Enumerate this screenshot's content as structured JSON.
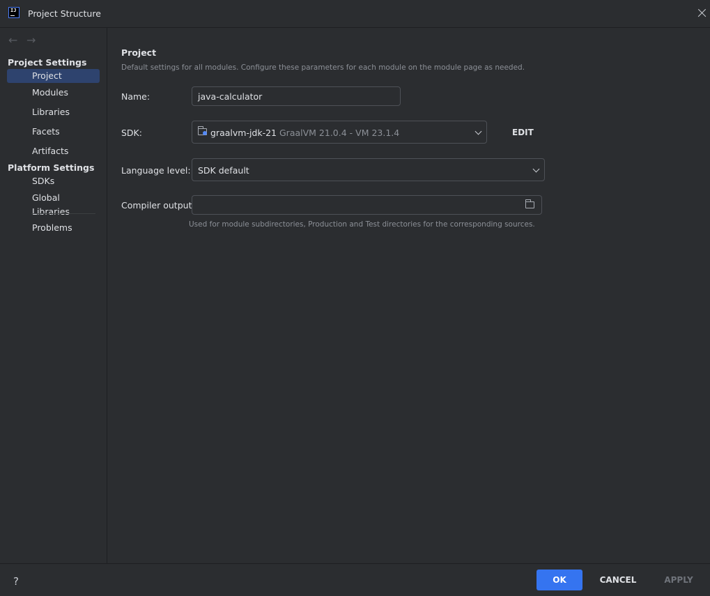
{
  "window": {
    "title": "Project Structure",
    "app_icon": "intellij-idea-icon"
  },
  "sidebar": {
    "back_icon": "←",
    "forward_icon": "→",
    "project_settings_title": "Project Settings",
    "project_settings_items": [
      "Project",
      "Modules",
      "Libraries",
      "Facets",
      "Artifacts"
    ],
    "platform_settings_title": "Platform Settings",
    "platform_settings_items": [
      "SDKs",
      "Global Libraries"
    ],
    "problems": "Problems",
    "selected": "Project"
  },
  "main": {
    "section_title": "Project",
    "section_description": "Default settings for all modules. Configure these parameters for each module on the module page as needed.",
    "name_label": "Name:",
    "name_value": "java-calculator",
    "sdk_label": "SDK:",
    "sdk_name": "graalvm-jdk-21",
    "sdk_detail": "GraalVM 21.0.4 - VM 23.1.4",
    "sdk_edit": "EDIT",
    "language_level_label": "Language level:",
    "language_level_value": "SDK default",
    "compiler_output_label": "Compiler output:",
    "compiler_output_value": "",
    "compiler_output_hint": "Used for module subdirectories, Production and Test directories for the corresponding sources."
  },
  "footer": {
    "help": "?",
    "ok": "OK",
    "cancel": "CANCEL",
    "apply": "APPLY"
  },
  "colors": {
    "background": "#2b2d30",
    "selection": "#2e436e",
    "primary_button": "#3574f0",
    "muted_text": "#8c9097"
  }
}
